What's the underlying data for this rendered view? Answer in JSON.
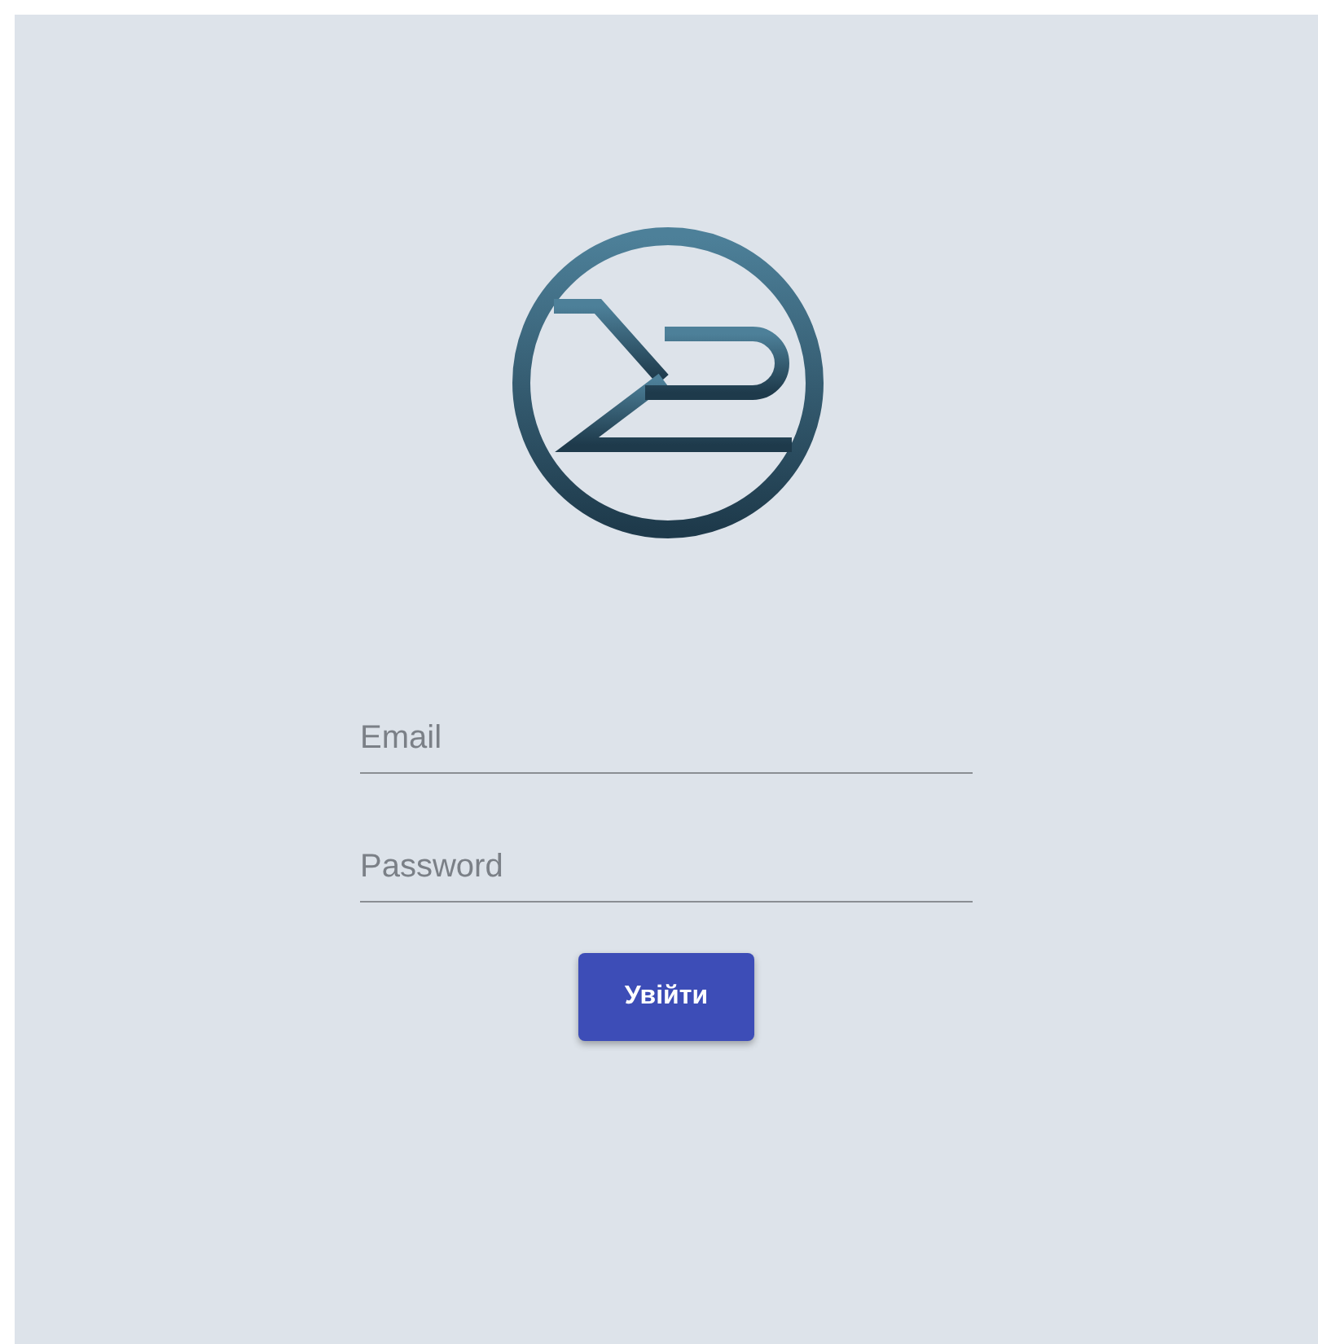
{
  "fields": [
    {
      "placeholder": "Email"
    },
    {
      "placeholder": "Password"
    }
  ],
  "button": {
    "label": "Увійти"
  }
}
